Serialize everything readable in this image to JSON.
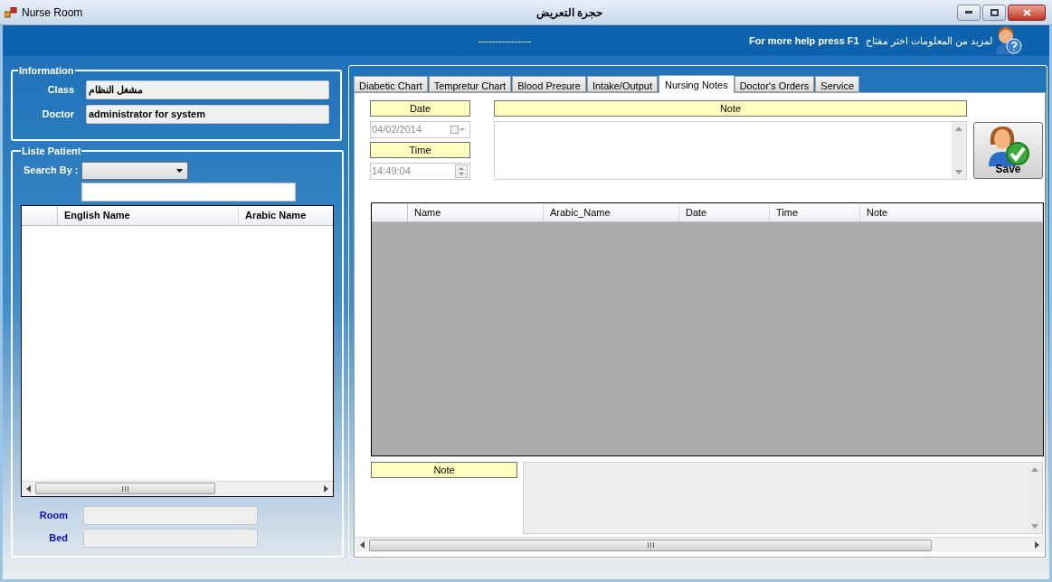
{
  "window": {
    "title": "Nurse Room",
    "caption": "حجرة التعريض"
  },
  "header": {
    "dashes": "----------------",
    "help_text": "For more help press F1",
    "help_text_ar": "لمزيد من المعلومات اختر مفتاح"
  },
  "information": {
    "title": "Information",
    "fields": [
      {
        "label": "Class",
        "value": "مشغل النظام"
      },
      {
        "label": "Doctor",
        "value": "administrator for system"
      }
    ]
  },
  "patients": {
    "title": "Liste Patient",
    "search_label": "Search By :",
    "columns": [
      "English Name",
      "Arabic Name"
    ],
    "room_label": "Room",
    "bed_label": "Bed"
  },
  "tabs": [
    {
      "label": "Diabetic Chart",
      "selected": false
    },
    {
      "label": "Tempretur Chart",
      "selected": false
    },
    {
      "label": "Blood Presure",
      "selected": false
    },
    {
      "label": "Intake/Output",
      "selected": false
    },
    {
      "label": "Nursing Notes",
      "selected": true
    },
    {
      "label": "Doctor's Orders",
      "selected": false
    },
    {
      "label": "Service",
      "selected": false
    }
  ],
  "nursing_notes": {
    "date_label": "Date",
    "date_value": "04/02/2014",
    "time_label": "Time",
    "time_value": "14:49:04",
    "note_label": "Note",
    "save_label": "Save",
    "columns": [
      "Name",
      "Arabic_Name",
      "Date",
      "Time",
      "Note"
    ],
    "bottom_note_label": "Note"
  }
}
